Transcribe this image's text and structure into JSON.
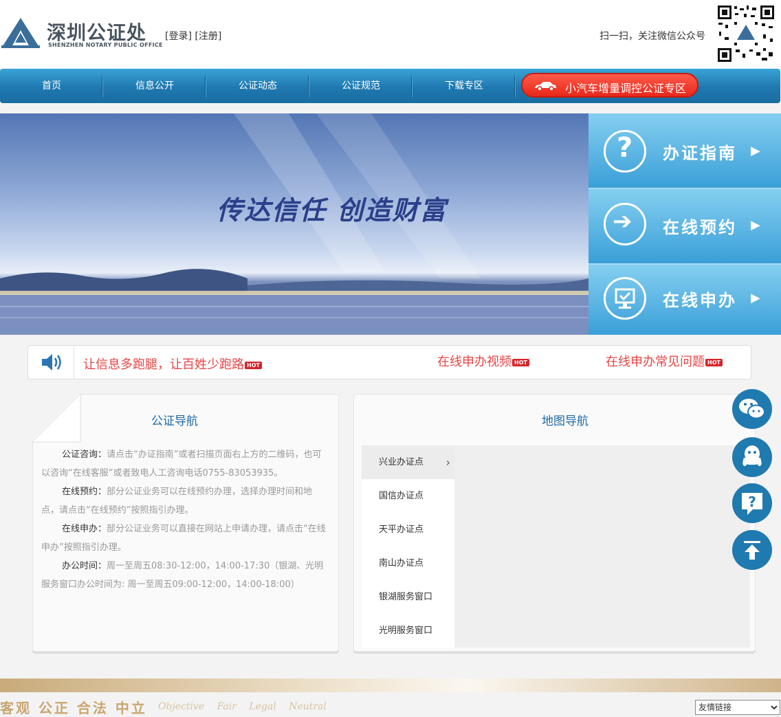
{
  "header": {
    "logo_cn": "深圳公证处",
    "logo_en": "SHENZHEN NOTARY PUBLIC OFFICE",
    "login": "[登录]",
    "register": "[注册]",
    "wechat_text": "扫一扫，关注微信公众号"
  },
  "nav": {
    "items": [
      "首页",
      "信息公开",
      "公证动态",
      "公证规范",
      "下载专区"
    ],
    "highlight": "小汽车增量调控公证专区"
  },
  "banner": {
    "slogan": "传达信任  创造财富"
  },
  "side_panel": {
    "items": [
      {
        "label": "办证指南",
        "icon": "question-icon"
      },
      {
        "label": "在线预约",
        "icon": "arrow-right-icon"
      },
      {
        "label": "在线申办",
        "icon": "monitor-check-icon"
      }
    ]
  },
  "notice": {
    "main": "让信息多跑腿，让百姓少跑路",
    "video": "在线申办视频",
    "faq": "在线申办常见问题",
    "hot": "HOT"
  },
  "guide": {
    "title": "公证导航",
    "paragraphs": [
      {
        "label": "公证咨询：",
        "text": "请点击“办证指南”或者扫描页面右上方的二维码，也可以咨询“在线客服”或者致电人工咨询电话0755-83053935。"
      },
      {
        "label": "在线预约：",
        "text": "部分公证业务可以在线预约办理，选择办理时间和地点，请点击“在线预约”按照指引办理。"
      },
      {
        "label": "在线申办：",
        "text": "部分公证业务可以直接在网站上申请办理，请点击“在线申办”按照指引办理。"
      },
      {
        "label": "办公时间：",
        "text": "周一至周五08:30-12:00，14:00-17:30（银湖、光明服务窗口办公时间为: 周一至周五09:00-12:00，14:00-18:00）"
      }
    ]
  },
  "map": {
    "title": "地图导航",
    "tabs": [
      "兴业办证点",
      "国信办证点",
      "天平办证点",
      "南山办证点",
      "银湖服务窗口",
      "光明服务窗口"
    ]
  },
  "footer": {
    "motto": "客观 公正 合法 中立",
    "motto_en": "Objective Fair Legal Neutral",
    "links_select": "友情链接"
  },
  "colors": {
    "nav_blue": "#1f79b0",
    "accent_red": "#e64545",
    "title_blue": "#1c6aa5"
  }
}
